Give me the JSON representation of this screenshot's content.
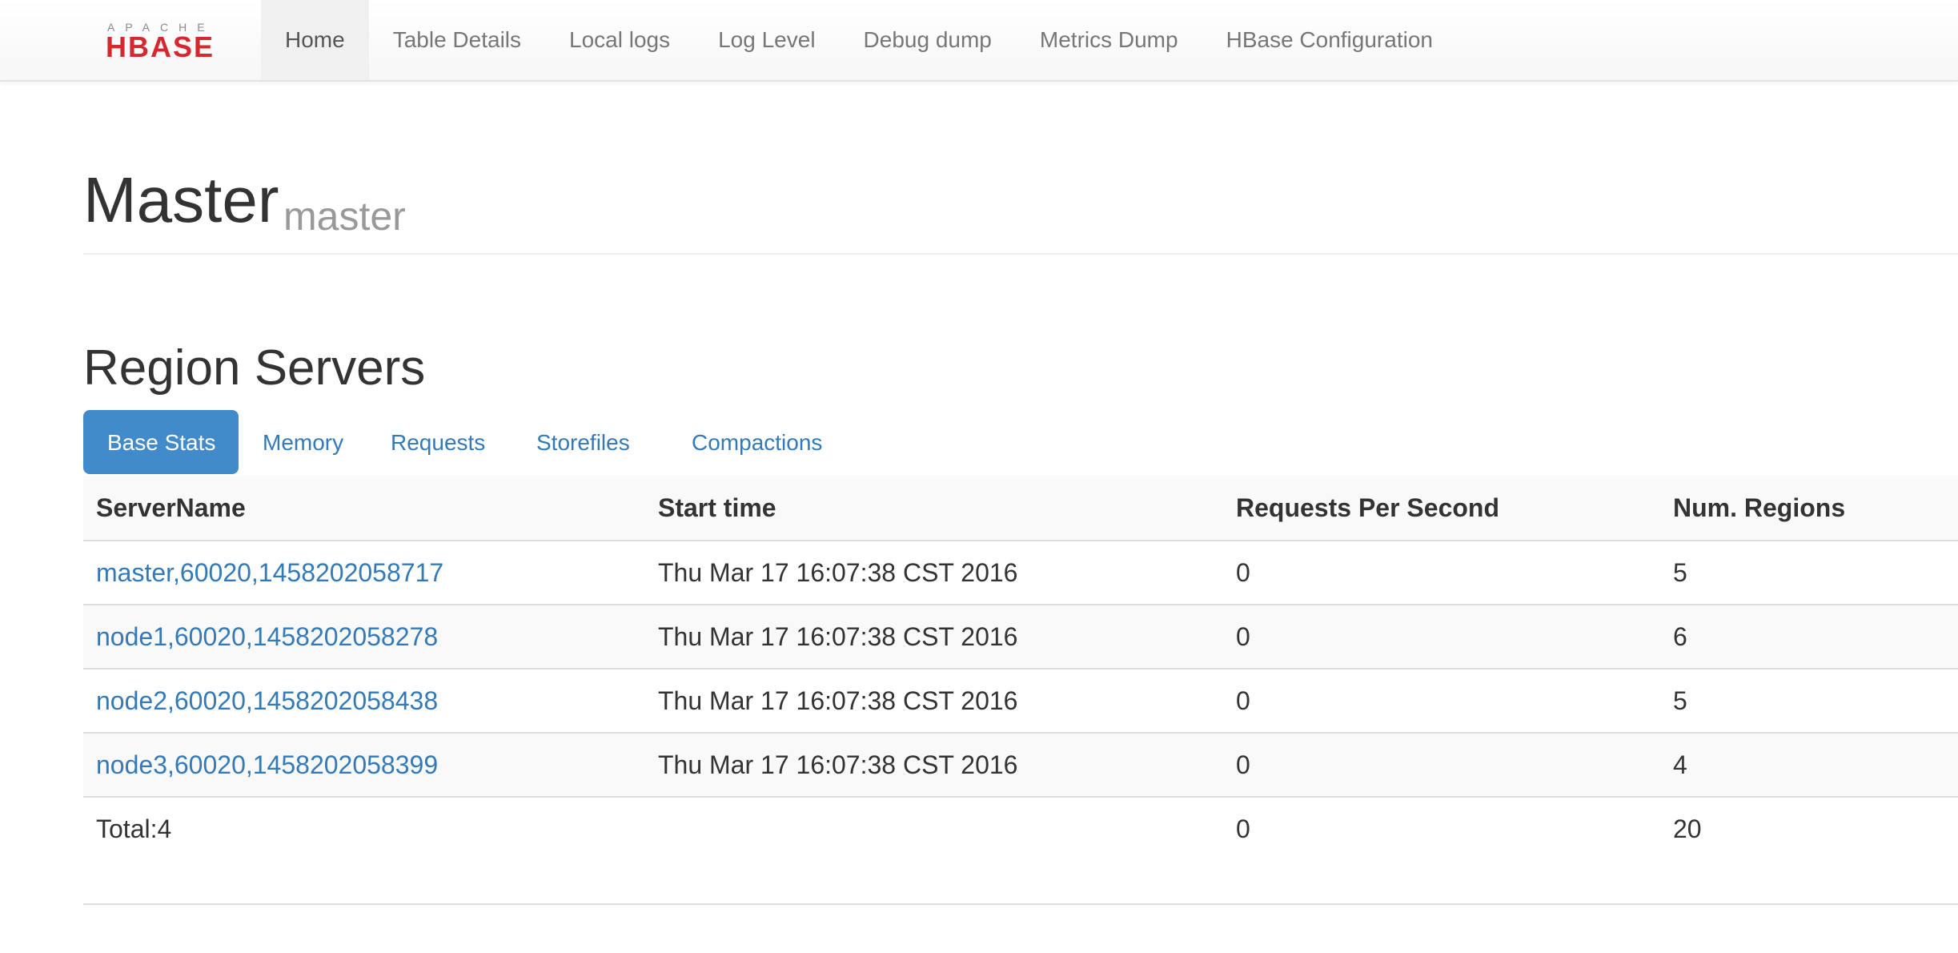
{
  "logo": {
    "top_text": "APACHE",
    "main_text": "HBASE"
  },
  "nav": [
    {
      "label": "Home",
      "active": true
    },
    {
      "label": "Table Details"
    },
    {
      "label": "Local logs"
    },
    {
      "label": "Log Level"
    },
    {
      "label": "Debug dump"
    },
    {
      "label": "Metrics Dump"
    },
    {
      "label": "HBase Configuration"
    }
  ],
  "header": {
    "title": "Master",
    "subtitle": "master"
  },
  "region_servers": {
    "title": "Region Servers",
    "tabs": [
      {
        "label": "Base Stats",
        "active": true
      },
      {
        "label": "Memory"
      },
      {
        "label": "Requests"
      },
      {
        "label": "Storefiles"
      },
      {
        "label": "Compactions"
      }
    ],
    "columns": [
      "ServerName",
      "Start time",
      "Requests Per Second",
      "Num. Regions"
    ],
    "rows": [
      {
        "server": "master,60020,1458202058717",
        "start": "Thu Mar 17 16:07:38 CST 2016",
        "rps": "0",
        "regions": "5"
      },
      {
        "server": "node1,60020,1458202058278",
        "start": "Thu Mar 17 16:07:38 CST 2016",
        "rps": "0",
        "regions": "6"
      },
      {
        "server": "node2,60020,1458202058438",
        "start": "Thu Mar 17 16:07:38 CST 2016",
        "rps": "0",
        "regions": "5"
      },
      {
        "server": "node3,60020,1458202058399",
        "start": "Thu Mar 17 16:07:38 CST 2016",
        "rps": "0",
        "regions": "4"
      }
    ],
    "total": {
      "label": "Total:4",
      "start": "",
      "rps": "0",
      "regions": "20"
    }
  },
  "colors": {
    "link": "#337ab7",
    "active_tab": "#428bca",
    "logo_red": "#d5292f"
  }
}
